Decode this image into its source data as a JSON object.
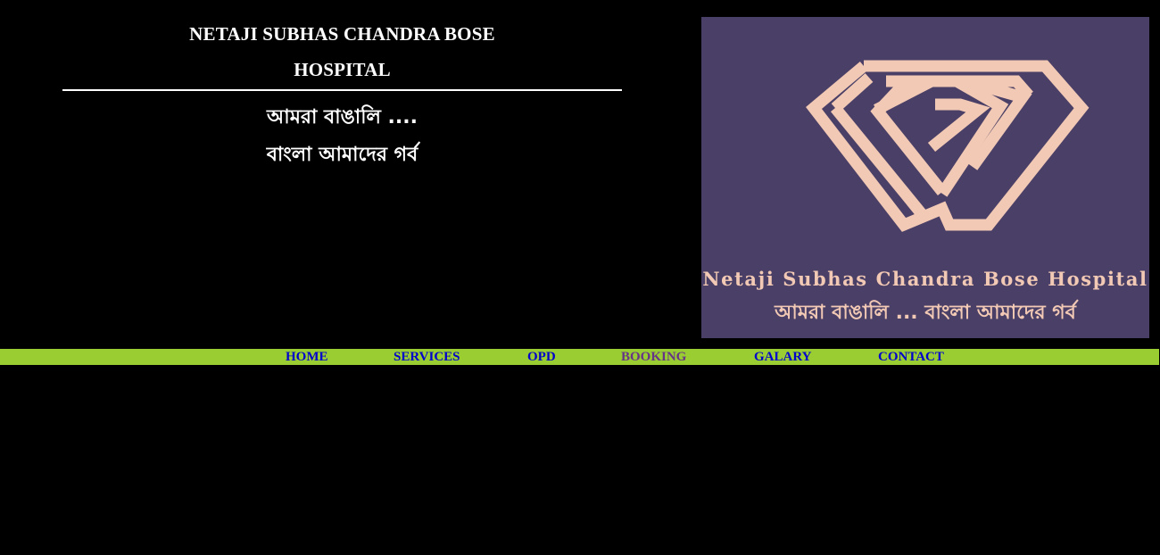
{
  "header": {
    "title_line1": "NETAJI SUBHAS CHANDRA BOSE",
    "title_line2": "HOSPITAL",
    "tagline1": "আমরা বাঙালি ....",
    "tagline2": "বাংলা আমাদের গর্ব"
  },
  "logo": {
    "name": "Netaji Subhas Chandra Bose Hospital",
    "tagline": "আমরা বাঙালি ... বাংলা আমাদের গর্ব",
    "icon": "diamond-logo-icon",
    "background_color": "#4a3f66",
    "accent_color": "#f2c9b4"
  },
  "nav": {
    "background_color": "#9acd32",
    "link_color": "#0000cc",
    "visited_color": "#663388",
    "items": [
      {
        "label": "HOME"
      },
      {
        "label": "SERVICES"
      },
      {
        "label": "OPD"
      },
      {
        "label": "BOOKING"
      },
      {
        "label": "GALARY"
      },
      {
        "label": "CONTACT"
      }
    ]
  }
}
